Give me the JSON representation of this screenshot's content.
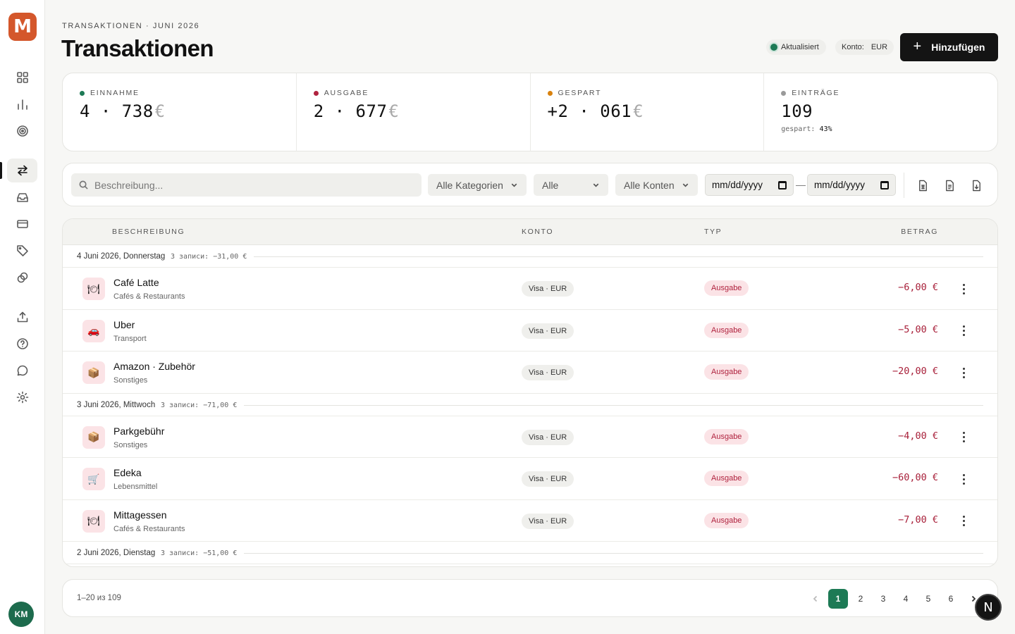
{
  "app": {
    "logo_letter": "M",
    "user_initials": "KM"
  },
  "header": {
    "eyebrow": "TRANSAKTIONEN · JUNI 2026",
    "title": "Transaktionen",
    "status_label": "Aktualisiert",
    "konto_label": "Konto:",
    "konto_value": "EUR",
    "add_label": "Hinzufügen"
  },
  "stats": [
    {
      "label": "EINNAHME",
      "value": "4 · 738",
      "currency": "€",
      "dot_color": "#1d7a55"
    },
    {
      "label": "AUSGABE",
      "value": "2 · 677",
      "currency": "€",
      "dot_color": "#b0233f"
    },
    {
      "label": "GESPART",
      "value": "+2 · 061",
      "currency": "€",
      "dot_color": "#d9820e"
    },
    {
      "label": "EINTRÄGE",
      "value": "109",
      "sub_label": "gespart:",
      "sub_value": "43%",
      "dot_color": "#9a9a9a"
    }
  ],
  "filters": {
    "search_placeholder": "Beschreibung...",
    "category": "Alle Kategorien",
    "type": "Alle",
    "account": "Alle Konten",
    "date_from": "mm/dd/yyyy",
    "date_to": "mm/dd/yyyy",
    "dash": "—"
  },
  "table": {
    "headers": {
      "description": "BESCHREIBUNG",
      "account": "KONTO",
      "type": "TYP",
      "amount": "BETRAG"
    },
    "groups": [
      {
        "title": "4 Juni 2026, Donnerstag",
        "summary": "3 записи: −31,00 €",
        "rows": [
          {
            "icon": "🍽",
            "name": "Café Latte",
            "category": "Cafés & Restaurants",
            "account": "Visa · EUR",
            "type": "Ausgabe",
            "amount": "−6,00 €"
          },
          {
            "icon": "🚗",
            "name": "Uber",
            "category": "Transport",
            "account": "Visa · EUR",
            "type": "Ausgabe",
            "amount": "−5,00 €"
          },
          {
            "icon": "📦",
            "name": "Amazon · Zubehör",
            "category": "Sonstiges",
            "account": "Visa · EUR",
            "type": "Ausgabe",
            "amount": "−20,00 €"
          }
        ]
      },
      {
        "title": "3 Juni 2026, Mittwoch",
        "summary": "3 записи: −71,00 €",
        "rows": [
          {
            "icon": "📦",
            "name": "Parkgebühr",
            "category": "Sonstiges",
            "account": "Visa · EUR",
            "type": "Ausgabe",
            "amount": "−4,00 €"
          },
          {
            "icon": "🛒",
            "name": "Edeka",
            "category": "Lebensmittel",
            "account": "Visa · EUR",
            "type": "Ausgabe",
            "amount": "−60,00 €"
          },
          {
            "icon": "🍽",
            "name": "Mittagessen",
            "category": "Cafés & Restaurants",
            "account": "Visa · EUR",
            "type": "Ausgabe",
            "amount": "−7,00 €"
          }
        ]
      },
      {
        "title": "2 Juni 2026, Dienstag",
        "summary": "3 записи: −51,00 €",
        "rows": []
      }
    ]
  },
  "pagination": {
    "range": "1–20 из 109",
    "pages": [
      "1",
      "2",
      "3",
      "4",
      "5",
      "6"
    ],
    "current": "1"
  },
  "floating_badge": "N"
}
